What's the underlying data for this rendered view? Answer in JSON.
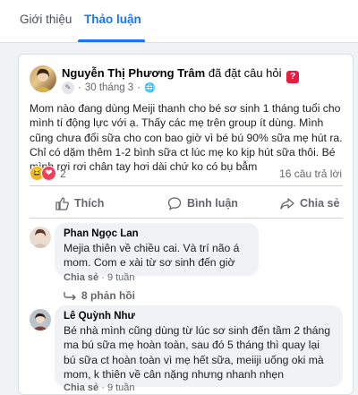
{
  "tabs": [
    {
      "label": "Giới thiệu"
    },
    {
      "label": "Thảo luận"
    }
  ],
  "post": {
    "author": "Nguyễn Thị Phương Trâm",
    "action_text": " đã đặt câu hỏi",
    "date": "30 tháng 3",
    "text": "Mom nào đang dùng Meiji thanh cho bé sơ sinh 1 tháng tuổi cho mình tí động lực với ạ. Thấy các mẹ trên group ít dùng. Mình cũng chưa đổi sữa cho con bao giờ vì bé bú 90% sữa mẹ hút ra. Chỉ có dặm thêm 1-2 bình sữa ct lúc mẹ ko kịp hút sữa thôi. Bé mình rơi rơi chân tay hơi dài chứ ko có bụ bẫm",
    "reaction_count": "2",
    "reply_count": "16 câu trả lời"
  },
  "actions": {
    "like": "Thích",
    "comment": "Bình luận",
    "share": "Chia sẻ"
  },
  "comments": [
    {
      "name": "Phan Ngọc Lan",
      "text": "Mejia thiên về chiều cai. Và trí não á mom. Com e xài từ sơ sinh đến giờ",
      "share_label": "Chia sẻ",
      "time": "9 tuần",
      "replies": "8 phản hồi"
    },
    {
      "name": "Lê Quỳnh Như",
      "text": "Bé nhà mình cũng dùng từ lúc sơ sinh đến tầm 2 tháng ma bú sữa mẹ hoàn toàn, sau đó 5 tháng thì quay lại bú sữa ct hoàn toàn vì mẹ hết sữa, meiiji uống oki mà mom, k thiên về cân nặng nhưng nhanh nhẹn",
      "share_label": "Chia sẻ",
      "time": "9 tuần"
    }
  ],
  "colors": {
    "accent": "#1877f2",
    "question_badge": "#e41e3f"
  }
}
